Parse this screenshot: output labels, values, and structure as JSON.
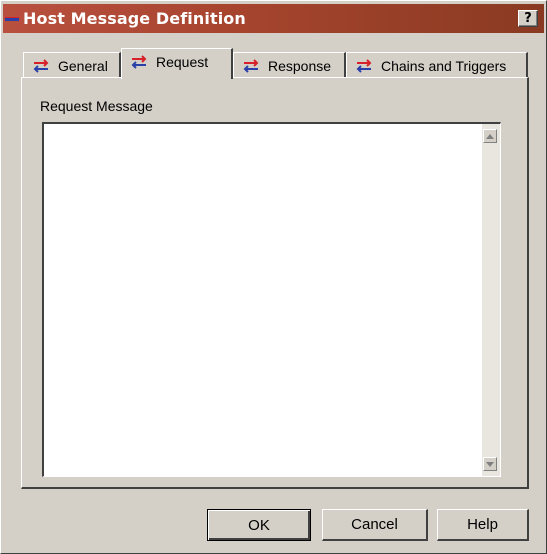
{
  "window": {
    "title": "Host Message Definition",
    "help_label": "?",
    "title_icon": "host-message-icon",
    "titlebar_color": "#a8452f"
  },
  "tabs": [
    {
      "label": "General",
      "icon": "message-arrows-icon",
      "active": false
    },
    {
      "label": "Request",
      "icon": "message-arrows-icon",
      "active": true
    },
    {
      "label": "Response",
      "icon": "message-arrows-icon",
      "active": false
    },
    {
      "label": "Chains and Triggers",
      "icon": "message-arrows-icon",
      "active": false
    }
  ],
  "panel": {
    "label": "Request Message",
    "message_value": ""
  },
  "buttons": {
    "ok": "OK",
    "cancel": "Cancel",
    "help": "Help"
  }
}
